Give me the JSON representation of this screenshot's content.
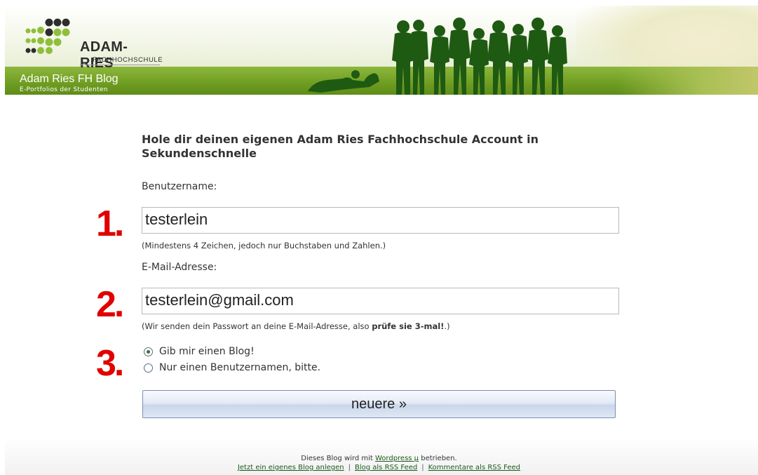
{
  "header": {
    "logo_title": "ADAM-RIES",
    "logo_subtitle": "FACHHOCHSCHULE",
    "blog_title": "Adam Ries FH Blog",
    "blog_subtitle": "E-Portfolios der Studenten"
  },
  "form": {
    "heading": "Hole dir deinen eigenen Adam Ries Fachhochschule Account in Sekundenschnelle",
    "username_label": "Benutzername:",
    "username_value": "testerlein",
    "username_hint": "(Mindestens 4 Zeichen, jedoch nur Buchstaben und Zahlen.)",
    "email_label": "E-Mail-Adresse:",
    "email_value": "testerlein@gmail.com",
    "email_hint_pre": "(Wir senden dein Passwort an deine E-Mail-Adresse, also ",
    "email_hint_bold": "prüfe sie 3-mal!",
    "email_hint_post": ".)",
    "options": [
      {
        "label": "Gib mir einen Blog!",
        "checked": true
      },
      {
        "label": "Nur einen Benutzernamen, bitte.",
        "checked": false
      }
    ],
    "submit_label": "neuere »"
  },
  "annotations": {
    "step1": "1.",
    "step2": "2.",
    "step3": "3."
  },
  "footer": {
    "text_pre": "Dieses Blog wird mit ",
    "wordpress_link": "Wordpress µ",
    "text_post": " betrieben.",
    "links": [
      "Jetzt ein eigenes Blog anlegen",
      "Blog als RSS Feed",
      "Kommentare als RSS Feed"
    ],
    "separator": "|"
  },
  "colors": {
    "annotation_red": "#e00000",
    "grass_green": "#6f9d22",
    "silhouette_green": "#1f5a13",
    "link_green": "#1d5a1d"
  }
}
